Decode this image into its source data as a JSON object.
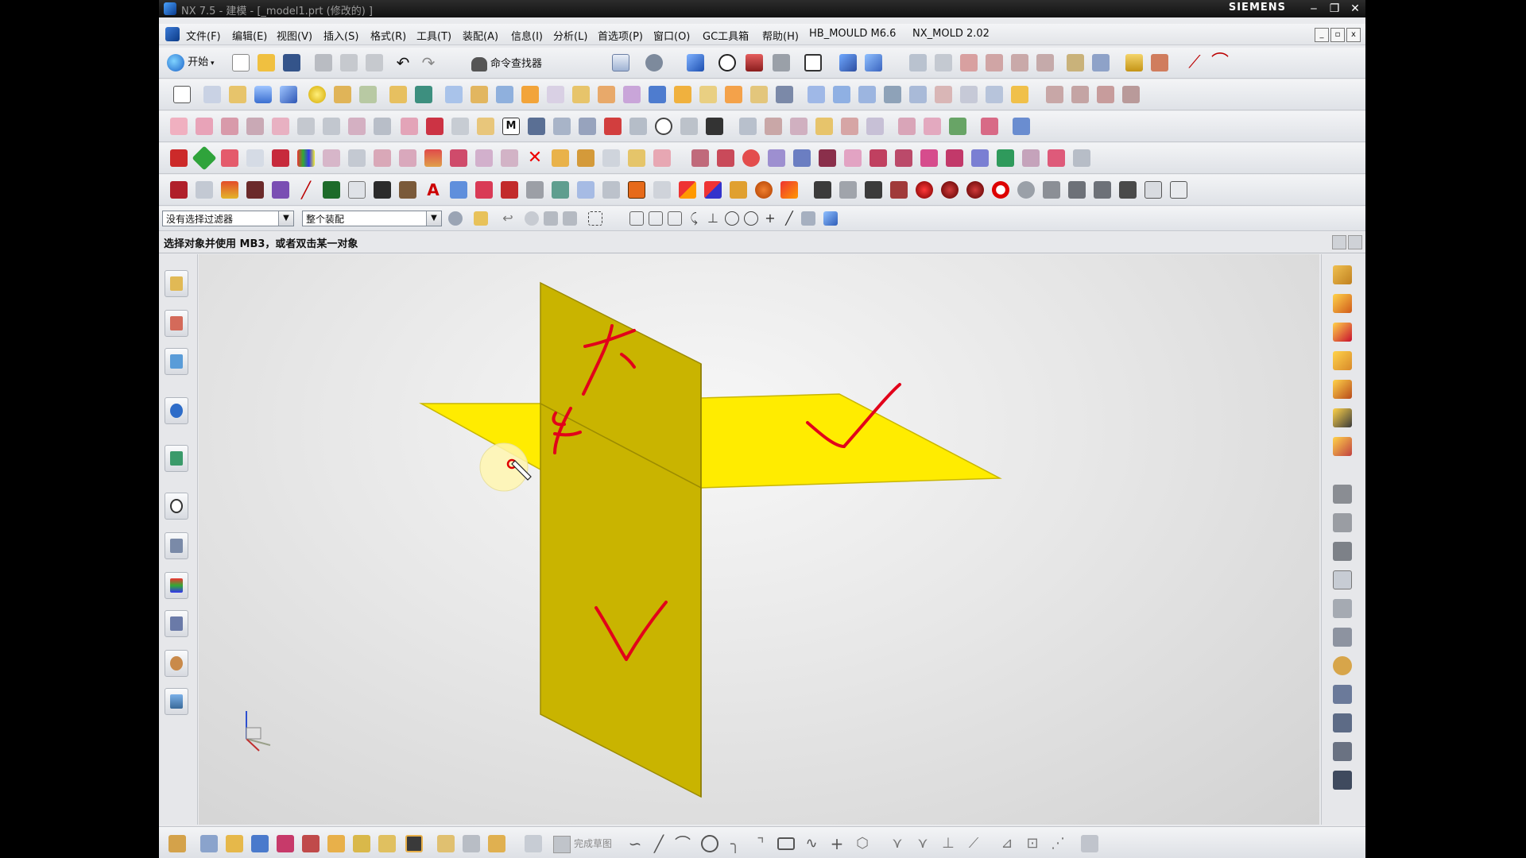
{
  "window": {
    "title": "NX 7.5 - 建模 - [_model1.prt (修改的) ]",
    "brand": "SIEMENS",
    "minimize": "‒",
    "maximize": "❐",
    "close": "✕"
  },
  "menu": {
    "items": [
      "文件(F)",
      "编辑(E)",
      "视图(V)",
      "插入(S)",
      "格式(R)",
      "工具(T)",
      "装配(A)",
      "信息(I)",
      "分析(L)",
      "首选项(P)",
      "窗口(O)",
      "GC工具箱",
      "帮助(H)",
      "HB_MOULD M6.6",
      "NX_MOLD 2.02"
    ]
  },
  "toolbar": {
    "start_label": "开始",
    "command_finder_label": "命令查找器"
  },
  "filter": {
    "type_filter": "没有选择过滤器",
    "scope": "整个装配"
  },
  "status": {
    "prompt": "选择对象并使用 MB3，或者双击某一对象"
  },
  "bottom": {
    "finish_sketch_label": "完成草图"
  },
  "colors": {
    "plane_front": "#ffec00",
    "plane_side": "#c9b400",
    "annotation": "#e2001a"
  },
  "icons": [
    "new-file-icon",
    "open-folder-icon",
    "save-icon",
    "cut-icon",
    "copy-icon",
    "paste-icon",
    "undo-icon",
    "redo-icon",
    "gear-icon",
    "magnifier-icon",
    "cursor-icon",
    "triad-icon"
  ]
}
